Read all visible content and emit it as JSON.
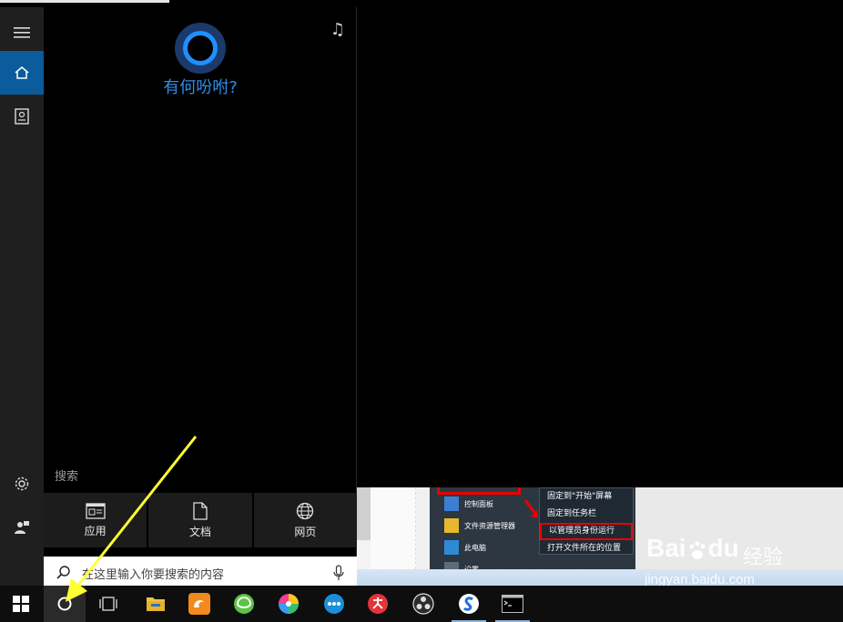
{
  "cortana": {
    "greeting": "有何吩咐?",
    "search_section_label": "搜索",
    "filters": [
      {
        "label": "应用",
        "icon": "apps-icon"
      },
      {
        "label": "文档",
        "icon": "document-icon"
      },
      {
        "label": "网页",
        "icon": "globe-icon"
      }
    ],
    "search_placeholder": "在这里输入你要搜索的内容"
  },
  "rail": {
    "items": [
      "menu-icon",
      "home-icon",
      "notebook-icon",
      "settings-icon",
      "feedback-icon"
    ]
  },
  "embedded_screenshot": {
    "list_items": [
      "控制面板",
      "文件资源管理器",
      "此电脑",
      "设置"
    ],
    "context_menu": [
      "固定到\"开始\"屏幕",
      "固定到任务栏",
      "以管理员身份运行",
      "打开文件所在的位置"
    ],
    "highlighted_index": 2
  },
  "watermark": {
    "brand": "Bai",
    "brand_tail": "du",
    "cn": "经验",
    "url": "jingyan.baidu.com"
  },
  "taskbar": {
    "items": [
      "start-icon",
      "cortana-icon",
      "task-view-icon",
      "file-explorer-icon",
      "uc-browser-icon",
      "360-browser-icon",
      "pinwheel-app-icon",
      "chat-app-icon",
      "xiu-app-icon",
      "obs-icon",
      "sogou-browser-icon",
      "command-prompt-icon"
    ]
  },
  "colors": {
    "accent": "#0a5c9c",
    "cortana_blue": "#1e90ff",
    "annotation_yellow": "#ffff33",
    "annotation_red": "#e00000"
  }
}
